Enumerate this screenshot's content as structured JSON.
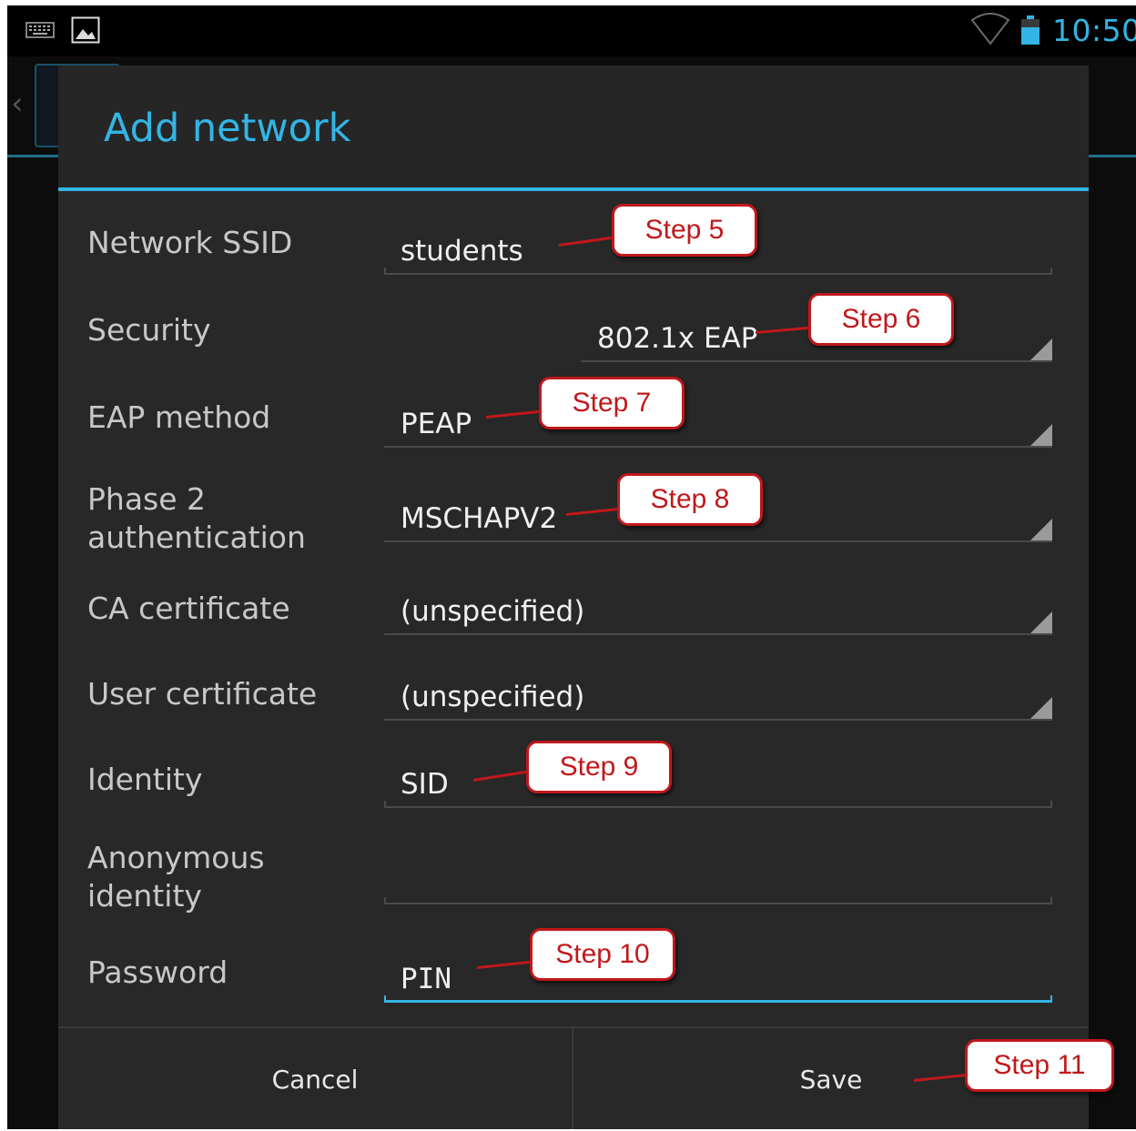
{
  "status_bar": {
    "time": "10:50",
    "icons": [
      "keyboard-icon",
      "image-notification-icon",
      "wifi-icon",
      "battery-icon"
    ],
    "accent_color": "#33b5e5"
  },
  "dialog": {
    "title": "Add network",
    "fields": [
      {
        "label": "Network SSID",
        "value": "students",
        "type": "text"
      },
      {
        "label": "Security",
        "value": "802.1x EAP",
        "type": "spinner"
      },
      {
        "label": "EAP method",
        "value": "PEAP",
        "type": "spinner"
      },
      {
        "label": "Phase 2 authentication",
        "value": "MSCHAPV2",
        "type": "spinner"
      },
      {
        "label": "CA certificate",
        "value": "(unspecified)",
        "type": "spinner"
      },
      {
        "label": "User certificate",
        "value": "(unspecified)",
        "type": "spinner"
      },
      {
        "label": "Identity",
        "value": "SID",
        "type": "text"
      },
      {
        "label": "Anonymous identity",
        "value": "",
        "type": "text"
      },
      {
        "label": "Password",
        "value": "PIN",
        "type": "password",
        "focused": true
      }
    ],
    "buttons": {
      "cancel": "Cancel",
      "save": "Save"
    }
  },
  "annotations": {
    "step5": "Step 5",
    "step6": "Step 6",
    "step7": "Step 7",
    "step8": "Step 8",
    "step9": "Step 9",
    "step10": "Step 10",
    "step11": "Step 11",
    "callout_color": "#c0181b"
  }
}
